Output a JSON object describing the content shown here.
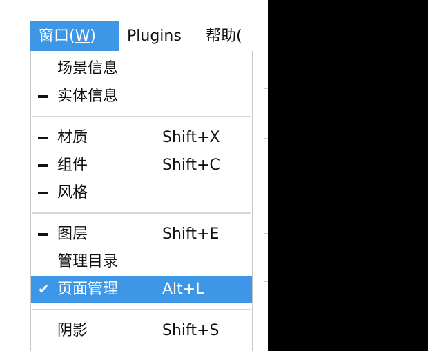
{
  "menubar": {
    "window": {
      "label": "窗口(",
      "accel": "W",
      "label_end": ")"
    },
    "plugins": "Plugins",
    "help": "帮助("
  },
  "menu": {
    "items": [
      {
        "label": "场景信息",
        "shortcut": "",
        "mark": "none"
      },
      {
        "label": "实体信息",
        "shortcut": "",
        "mark": "dash"
      },
      {
        "label": "材质",
        "shortcut": "Shift+X",
        "mark": "dash"
      },
      {
        "label": "组件",
        "shortcut": "Shift+C",
        "mark": "dash"
      },
      {
        "label": "风格",
        "shortcut": "",
        "mark": "dash"
      },
      {
        "label": "图层",
        "shortcut": "Shift+E",
        "mark": "dash"
      },
      {
        "label": "管理目录",
        "shortcut": "",
        "mark": "none"
      },
      {
        "label": "页面管理",
        "shortcut": "Alt+L",
        "mark": "check",
        "highlighted": true
      },
      {
        "label": "阴影",
        "shortcut": "Shift+S",
        "mark": "none"
      }
    ]
  },
  "colors": {
    "highlight": "#3d97e6",
    "text": "#111111",
    "panel": "#000000"
  },
  "icons": {
    "dash": "dash-mark-icon",
    "check": "checkmark-icon"
  }
}
